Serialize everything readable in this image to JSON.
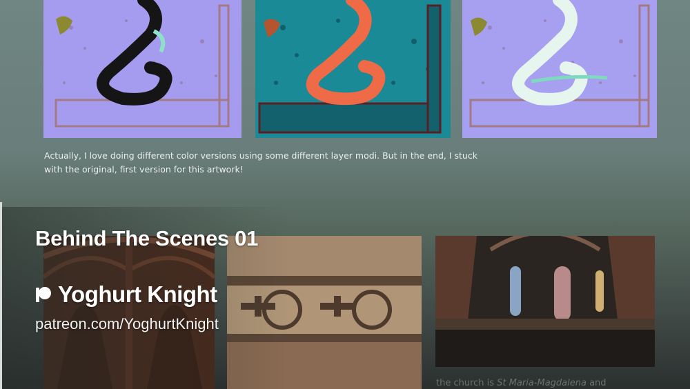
{
  "artworks": [
    {
      "name": "black dragon version",
      "background": "#a59cf0",
      "dragon": "#151515"
    },
    {
      "name": "orange dragon version",
      "background": "#1a8a97",
      "dragon": "#ef6a47"
    },
    {
      "name": "white dragon version",
      "background": "#a79ff0",
      "dragon": "#e6f6ee"
    }
  ],
  "post": {
    "caption": "Actually, I love doing different color versions using some different layer modi. But in the end, I stuck with the original, first version for this artwork!",
    "church_caption_prefix": "the church is ",
    "church_caption_name": "St Maria-Magdalena",
    "church_caption_suffix": " and"
  },
  "overlay": {
    "title": "Behind The Scenes 01",
    "creator_name": "Yoghurt Knight",
    "creator_url": "patreon.com/YoghurtKnight",
    "platform_icon": "patreon-icon"
  }
}
